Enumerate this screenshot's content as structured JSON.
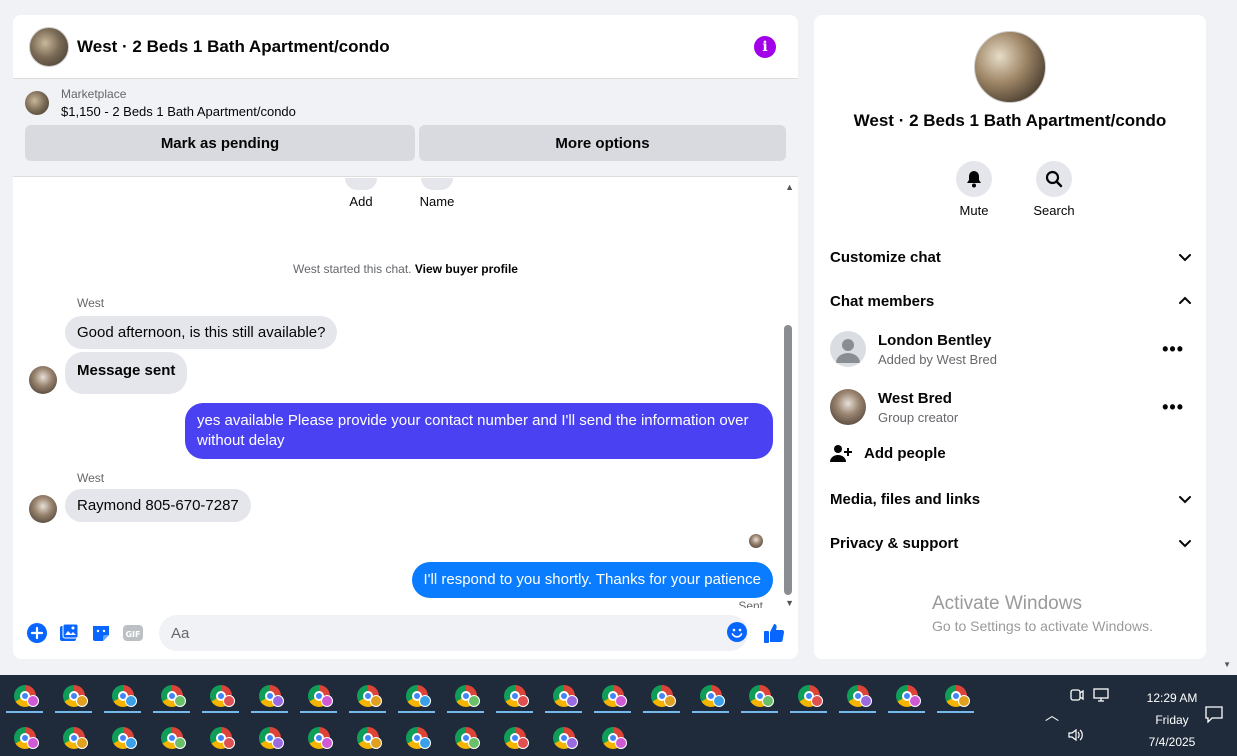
{
  "chat": {
    "title": "West · 2 Beds 1 Bath Apartment/condo",
    "info_icon": "i",
    "marketplace": {
      "label": "Marketplace",
      "listing": "$1,150 - 2 Beds 1 Bath Apartment/condo",
      "mark_pending": "Mark as pending",
      "more_options": "More options"
    },
    "actions": {
      "add": "Add",
      "name": "Name"
    },
    "system": {
      "started": "West started this chat. ",
      "view_profile": "View buyer profile"
    },
    "messages": [
      {
        "sender": "West",
        "text": "Good afternoon, is this still available?"
      },
      {
        "text": "Message sent"
      },
      {
        "text": "yes available Please provide your contact number and I'll send the information over without delay"
      },
      {
        "sender": "West",
        "text": "Raymond 805-670-7287"
      },
      {
        "text": "I'll respond to you shortly. Thanks for your patience"
      }
    ],
    "status": "Sent",
    "composer_placeholder": "Aa"
  },
  "info": {
    "title": "West · 2 Beds 1 Bath Apartment/condo",
    "mute": "Mute",
    "search": "Search",
    "customize": "Customize chat",
    "members_header": "Chat members",
    "members": [
      {
        "name": "London Bentley",
        "sub": "Added by West Bred"
      },
      {
        "name": "West Bred",
        "sub": "Group creator"
      }
    ],
    "add_people": "Add people",
    "media": "Media, files and links",
    "privacy": "Privacy & support"
  },
  "watermark": {
    "title": "Activate Windows",
    "sub": "Go to Settings to activate Windows."
  },
  "taskbar": {
    "time": "12:29 AM",
    "day": "Friday",
    "date": "7/4/2025",
    "badge_colors": [
      "#d05ad6",
      "#e0a020",
      "#3aa0e8",
      "#6ac06a",
      "#e05050",
      "#9a6ae0"
    ]
  },
  "colors": {
    "outgoing_purple": "#4a41f2",
    "outgoing_blue": "#0a7cff",
    "accent": "#0866ff",
    "info_purple": "#a200e8"
  }
}
